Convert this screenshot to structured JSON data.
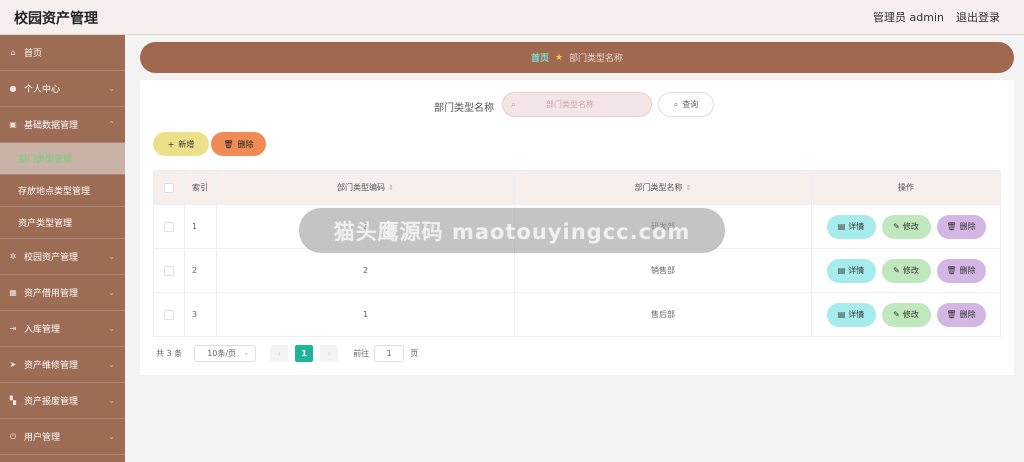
{
  "header": {
    "app_title": "校园资产管理",
    "user": "管理员 admin",
    "logout": "退出登录"
  },
  "sidebar": {
    "items": [
      {
        "label": "首页",
        "icon": "home-icon"
      },
      {
        "label": "个人中心",
        "icon": "user-icon"
      },
      {
        "label": "基础数据管理",
        "icon": "folder-icon"
      },
      {
        "label": "校园资产管理",
        "icon": "gear-icon"
      },
      {
        "label": "资产借用管理",
        "icon": "grid-icon"
      },
      {
        "label": "入库管理",
        "icon": "login-icon"
      },
      {
        "label": "资产维修管理",
        "icon": "send-icon"
      },
      {
        "label": "资产报废管理",
        "icon": "apps-icon"
      },
      {
        "label": "用户管理",
        "icon": "power-icon"
      }
    ],
    "sub_items": [
      "部门类型管理",
      "存放地点类型管理",
      "资产类型管理"
    ]
  },
  "breadcrumb": {
    "home": "首页",
    "current": "部门类型名称"
  },
  "search": {
    "label": "部门类型名称",
    "placeholder": "部门类型名称",
    "query_label": "查询"
  },
  "actions": {
    "add": "新增",
    "delete": "删除"
  },
  "table": {
    "headers": {
      "index": "索引",
      "code": "部门类型编码",
      "name": "部门类型名称",
      "ops": "操作"
    },
    "rows": [
      {
        "index": "1",
        "code": "3",
        "name": "研发部"
      },
      {
        "index": "2",
        "code": "2",
        "name": "销售部"
      },
      {
        "index": "3",
        "code": "1",
        "name": "售后部"
      }
    ],
    "op_labels": {
      "detail": "详情",
      "edit": "修改",
      "delete": "删除"
    }
  },
  "pagination": {
    "total": "共 3 条",
    "page_size": "10条/页",
    "current_page": "1",
    "goto_label": "前往",
    "goto_value": "1",
    "page_suffix": "页"
  },
  "watermark": "猫头鹰源码 maotouyingcc.com",
  "colors": {
    "sidebar": "#9c6c55",
    "breadcrumb": "#a0694f",
    "accent": "#1fb39a"
  }
}
